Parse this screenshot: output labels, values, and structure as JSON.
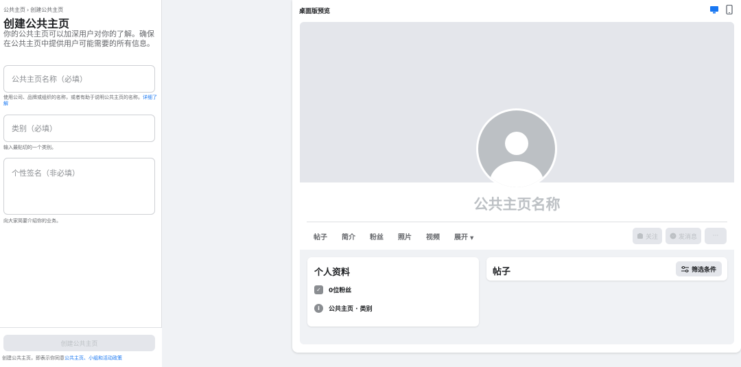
{
  "breadcrumb": {
    "parent": "公共主页",
    "separator": "›",
    "current": "创建公共主页"
  },
  "form": {
    "title": "创建公共主页",
    "description": "你的公共主页可以加深用户对你的了解。确保在公共主页中提供用户可能需要的所有信息。",
    "name_placeholder": "公共主页名称（必填）",
    "name_hint": "使用公司、品牌或组织的名称，或者有助于说明公共主页的名称。",
    "name_hint_link": "详细了解",
    "category_placeholder": "类别（必填）",
    "category_hint": "输入最贴切的一个类别。",
    "bio_placeholder": "个性签名（非必填）",
    "bio_hint": "向大家简要介绍你的业务。"
  },
  "footer": {
    "create_button": "创建公共主页",
    "terms_prefix": "创建公共主页，即表示你同意",
    "terms_link": "公共主页、小组和活动政策"
  },
  "preview": {
    "title": "桌面版预览",
    "desktop_icon": "desktop-icon",
    "mobile_icon": "mobile-icon",
    "page_name": "公共主页名称",
    "tabs": [
      "帖子",
      "简介",
      "粉丝",
      "照片",
      "视频",
      "展开"
    ],
    "more_caret": "▼",
    "follow_button": "关注",
    "message_button": "发消息",
    "more_button": "···",
    "about_title": "个人资料",
    "followers": "0位粉丝",
    "category_line": "公共主页 · 类别",
    "posts_title": "帖子",
    "filter_button": "筛选条件"
  },
  "colors": {
    "accent": "#1877f2",
    "disabled": "#bcc0c4",
    "surface": "#f0f2f5"
  }
}
